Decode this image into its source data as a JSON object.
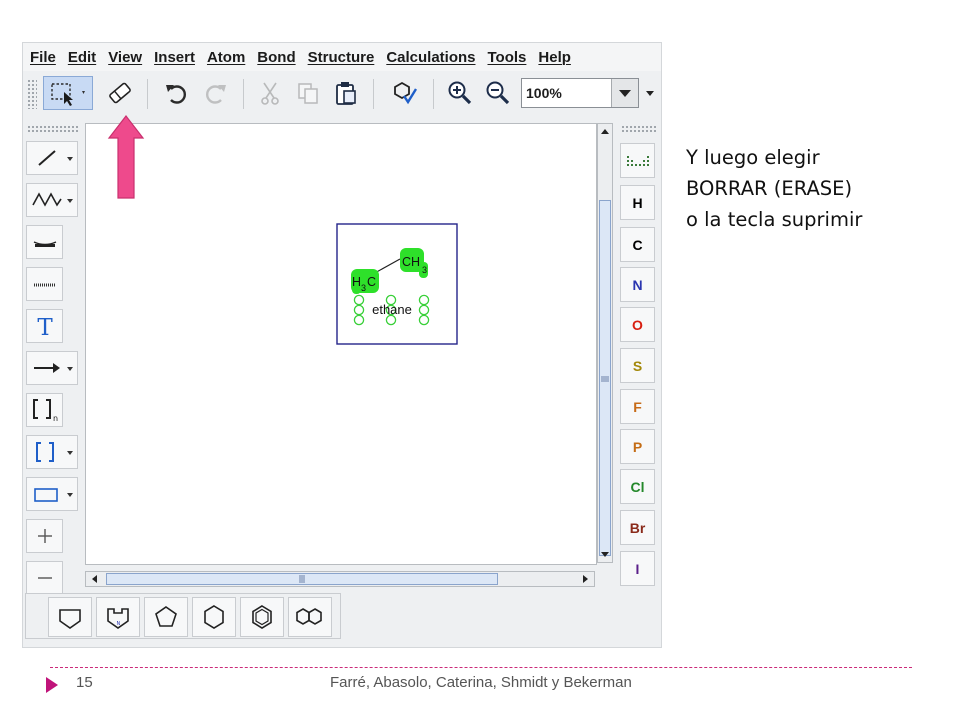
{
  "menu": [
    "File",
    "Edit",
    "View",
    "Insert",
    "Atom",
    "Bond",
    "Structure",
    "Calculations",
    "Tools",
    "Help"
  ],
  "toolbar": {
    "zoom_value": "100%"
  },
  "molecule": {
    "atom_right_label": "CH",
    "atom_right_sub": "3",
    "atom_left_label_h": "H",
    "atom_left_sub": "3",
    "atom_left_label_c": "C",
    "name": "ethane"
  },
  "elements": [
    "H",
    "C",
    "N",
    "O",
    "S",
    "F",
    "P",
    "Cl",
    "Br",
    "I"
  ],
  "element_colors": {
    "H": "#1a1a1a",
    "C": "#1a1a1a",
    "N": "#2a35b0",
    "O": "#d81e10",
    "S": "#a3880a",
    "F": "#c76b18",
    "P": "#c46c15",
    "Cl": "#23882a",
    "Br": "#8a2a1a",
    "I": "#5a1f8a"
  },
  "annotation": {
    "line1": "Y luego elegir",
    "line2": "BORRAR (ERASE)",
    "line3": "o la tecla suprimir"
  },
  "footer": {
    "page_number": "15",
    "authors": "Farré, Abasolo, Caterina, Shmidt y Bekerman"
  },
  "colors": {
    "accent_arrow": "#ee4a8c",
    "selection_green": "#2ee02a",
    "molecule_box": "#24248a"
  }
}
